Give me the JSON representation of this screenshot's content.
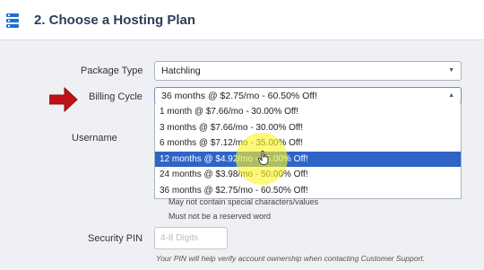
{
  "header": {
    "title": "2. Choose a Hosting Plan",
    "icon": "server-icon"
  },
  "form": {
    "package_type": {
      "label": "Package Type",
      "value": "Hatchling"
    },
    "billing_cycle": {
      "label": "Billing Cycle",
      "value": "36 months @ $2.75/mo - 60.50% Off!",
      "options": [
        "1 month @ $7.66/mo - 30.00% Off!",
        "3 months @ $7.66/mo - 30.00% Off!",
        "6 months @ $7.12/mo - 35.00% Off!",
        "12 months @ $4.92/mo - 45.00% Off!",
        "24 months @ $3.98/mo - 50.00% Off!",
        "36 months @ $2.75/mo - 60.50% Off!"
      ],
      "highlighted_index": 3
    },
    "username": {
      "label": "Username",
      "hints": [
        "May not contain special characters/values",
        "Must not be a reserved word"
      ]
    },
    "security_pin": {
      "label": "Security PIN",
      "placeholder": "4-8 Digits",
      "note": "Your PIN will help verify account ownership when contacting Customer Support."
    }
  },
  "colors": {
    "accent": "#1e6fd0",
    "selected_option": "#2f64c7",
    "arrow": "#c0101a",
    "highlight": "#faf528"
  }
}
